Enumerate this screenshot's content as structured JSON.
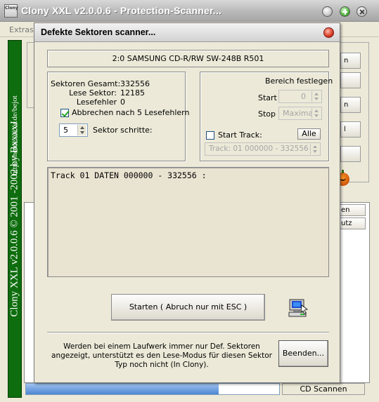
{
  "main_window": {
    "title": "Clony XXL v2.0.0.6 - Protection-Scanner...",
    "app_icon_text": "Clony",
    "menu": [
      "Extras"
    ],
    "banner_text": "Clony XXL v2.0.0.6   © 2001 -2002 by BxxxxJ",
    "banner_url": "http://home.arcor.de/bejot",
    "bg_buttons": [
      "n",
      "",
      "n",
      "l",
      ""
    ],
    "bg_tabs": [
      "en",
      "utz"
    ],
    "status_right": "CD Scannen",
    "progress_fraction": 0.76
  },
  "dialog": {
    "title": "Defekte Sektoren scanner...",
    "drive": "2:0 SAMSUNG CD-R/RW SW-248B R501",
    "left": {
      "sektoren_gesamt_label": "Sektoren Gesamt:",
      "sektoren_gesamt_value": "332556",
      "lese_sektor_label": "Lese Sektor:",
      "lese_sektor_value": "12185",
      "lesefehler_label": "Lesefehler",
      "lesefehler_value": "0",
      "abbrechen_label": "Abbrechen nach 5 Lesefehlern",
      "abbrechen_checked": true,
      "sektor_schritte_value": "5",
      "sektor_schritte_label": "Sektor schritte:"
    },
    "right": {
      "heading": "Bereich festlegen",
      "start_label": "Start",
      "start_value": "0",
      "stop_label": "Stop",
      "stop_value": "Maximal",
      "start_track_label": "Start Track:",
      "start_track_checked": false,
      "alle_label": "Alle",
      "track_select": "Track: 01 000000 - 332556"
    },
    "log": "Track 01 DATEN 000000 - 332556 :",
    "start_button": "Starten  ( Abruch nur mit ESC )",
    "info_text": "Werden bei einem Laufwerk immer nur Def. Sektoren angezeigt, unterstützt es den Lese-Modus für diesen Sektor Typ noch nicht (In Clony).",
    "quit_button": "Beenden..."
  }
}
